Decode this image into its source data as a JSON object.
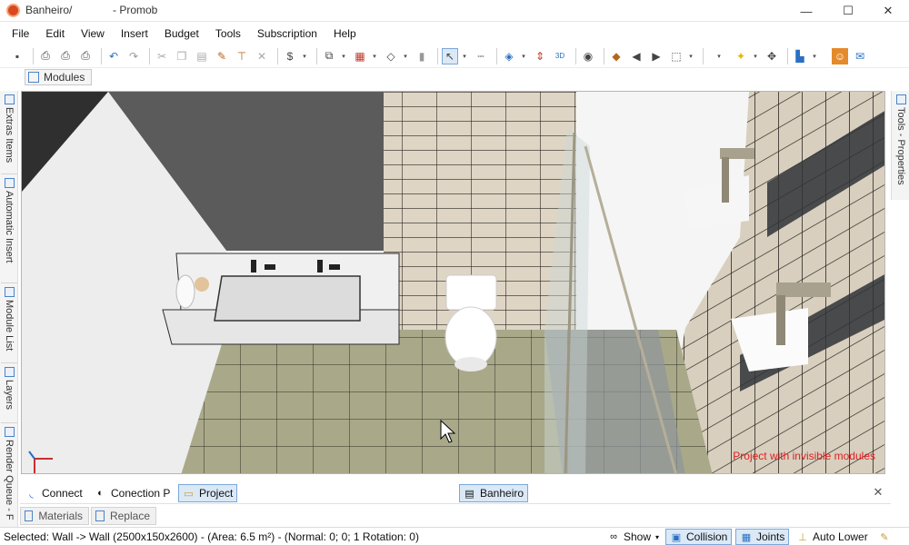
{
  "window": {
    "title": "Banheiro/",
    "app_name": "- Promob",
    "minimize": "—",
    "maximize": "☐",
    "close": "✕"
  },
  "menu": [
    "File",
    "Edit",
    "View",
    "Insert",
    "Budget",
    "Tools",
    "Subscription",
    "Help"
  ],
  "toolbar_icons": [
    "save-icon",
    "print-icon",
    "print-preview-icon",
    "printer-icon",
    "undo-icon",
    "redo-icon",
    "cut-icon",
    "copy-icon",
    "paste-icon",
    "paint-icon",
    "format-icon",
    "delete-icon",
    "budget-icon",
    "group-icon",
    "align-icon",
    "shape-icon",
    "wall-icon",
    "select-icon",
    "measure-icon",
    "layers-icon",
    "dimension-icon",
    "3d-icon",
    "view-icon",
    "render-icon",
    "prev-icon",
    "next-icon",
    "camera-icon",
    "light-icon",
    "move-icon",
    "color-icon",
    "user-icon",
    "chat-icon"
  ],
  "modules_tab": "Modules",
  "left_tabs": [
    "Extras Items",
    "Automatic Insert",
    "Module List",
    "Layers",
    "Render Queue - F"
  ],
  "right_tabs": [
    "Tools - Properties"
  ],
  "viewport": {
    "message": "Project with invisible modules",
    "message_color": "#e02020"
  },
  "bottom_tabs": {
    "connect": "Connect",
    "conection_p": "Conection P",
    "project": "Project",
    "document": "Banheiro"
  },
  "lower_tabs": [
    "Materials",
    "Replace"
  ],
  "status": {
    "text": "Selected: Wall -> Wall (2500x150x2600) - (Area: 6.5 m²) - (Normal: 0; 0; 1 Rotation: 0)",
    "show": "Show",
    "collision": "Collision",
    "joints": "Joints",
    "auto_lower": "Auto Lower"
  },
  "colors": {
    "accent": "#4a84c7",
    "selected_bg": "#dbe9f7",
    "logo": "#d9481f"
  }
}
